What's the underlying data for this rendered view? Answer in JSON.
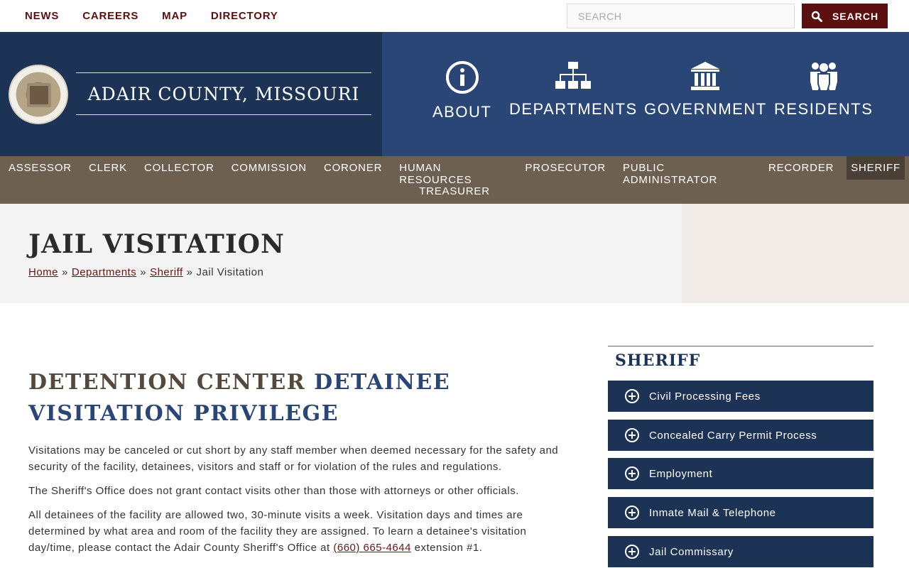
{
  "topnav": {
    "items": [
      "NEWS",
      "CAREERS",
      "MAP",
      "DIRECTORY"
    ]
  },
  "search": {
    "placeholder": "SEARCH",
    "button_label": "SEARCH"
  },
  "brand": {
    "title": "ADAIR COUNTY, MISSOURI"
  },
  "mainnav": {
    "items": [
      {
        "label": "ABOUT",
        "icon": "info-icon"
      },
      {
        "label": "DEPARTMENTS",
        "icon": "org-chart-icon"
      },
      {
        "label": "GOVERNMENT",
        "icon": "courthouse-icon"
      },
      {
        "label": "RESIDENTS",
        "icon": "people-icon"
      }
    ]
  },
  "departments": {
    "row1": [
      "ASSESSOR",
      "CLERK",
      "COLLECTOR",
      "COMMISSION",
      "CORONER",
      "HUMAN RESOURCES",
      "PROSECUTOR",
      "PUBLIC ADMINISTRATOR",
      "RECORDER",
      "SHERIFF"
    ],
    "row2": [
      "TREASURER"
    ],
    "active": "SHERIFF"
  },
  "page": {
    "title": "JAIL VISITATION",
    "breadcrumb": {
      "home": "Home",
      "sep": "»",
      "departments": "Departments",
      "sheriff": "Sheriff",
      "current": "Jail Visitation"
    }
  },
  "content": {
    "heading_part1": "DETENTION CENTER",
    "heading_part2": "DETAINEE VISITATION PRIVILEGE",
    "p1": "Visitations may be canceled or cut short by any staff member when deemed necessary for the safety and security of the facility, detainees, visitors and staff or for violation of the rules and regulations.",
    "p2": "The Sheriff's Office does not grant contact visits other than those with attorneys or other officials.",
    "p3_before": "All detainees of the facility are allowed two, 30-minute visits a week. Visitation days and times are determined by what area and room of the facility they are assigned. To learn a detainee's visitation day/time, please contact the Adair County Sheriff's Office at",
    "p3_phone": "(660) 665-4644",
    "p3_after": "extension #1."
  },
  "sidebar": {
    "title": "SHERIFF",
    "items": [
      "Civil Processing Fees",
      "Concealed Carry Permit Process",
      "Employment",
      "Inmate Mail & Telephone",
      "Jail Commissary"
    ]
  },
  "colors": {
    "navy": "#1d3356",
    "blue": "#2a4677",
    "maroon": "#5c0f0f",
    "taupe": "#6e6050"
  }
}
